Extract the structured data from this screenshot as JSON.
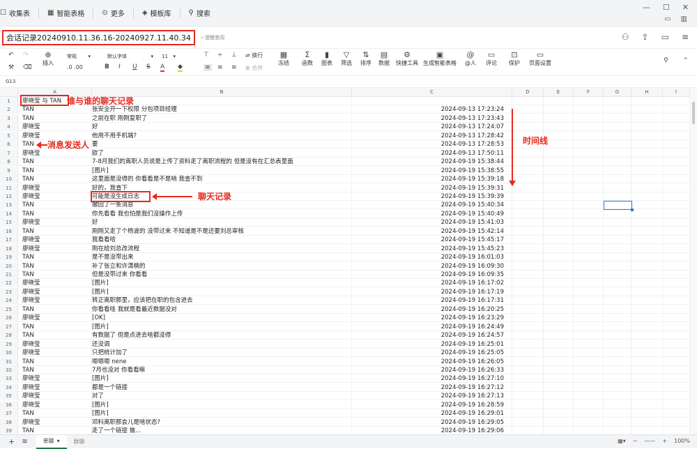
{
  "topbar": {
    "items": [
      {
        "icon": "star-icon",
        "label": "收集表"
      },
      {
        "icon": "table-icon",
        "label": "智能表格"
      },
      {
        "icon": "more-icon",
        "label": "更多"
      },
      {
        "icon": "template-icon",
        "label": "模板库"
      },
      {
        "icon": "search-icon",
        "label": "搜索"
      }
    ]
  },
  "doc": {
    "title": "会话记录20240910.11.36.16-20240927.11.40.34",
    "tag": "提醒查阅"
  },
  "ribbon": {
    "font_format": "常规",
    "font_name": "默认字体",
    "font_size": "11",
    "wrap": "换行",
    "merge": "合并",
    "insert": "插入",
    "groups": [
      "冻结",
      "函数",
      "图表",
      "筛选",
      "排序",
      "数据",
      "快捷工具",
      "生成智能表格",
      "@人",
      "评论",
      "保护",
      "页面设置"
    ]
  },
  "formula": {
    "cell_ref": "G13"
  },
  "columns": [
    "A",
    "B",
    "C",
    "D",
    "E",
    "F",
    "G",
    "H",
    "I"
  ],
  "rows": [
    {
      "a": "廖晓莹 与 TAN",
      "b": "",
      "c": ""
    },
    {
      "a": "TAN",
      "b": "张安全开一下权限  分包项目经理",
      "c": "2024-09-13 17:23:24"
    },
    {
      "a": "TAN",
      "b": "之前在职  刚刚复职了",
      "c": "2024-09-13 17:23:43"
    },
    {
      "a": "廖晓莹",
      "b": "好",
      "c": "2024-09-13 17:24:07"
    },
    {
      "a": "廖晓莹",
      "b": "他用不用手机端?",
      "c": "2024-09-13 17:28:42"
    },
    {
      "a": "TAN",
      "b": "要",
      "c": "2024-09-13 17:28:53"
    },
    {
      "a": "廖晓莹",
      "b": "欧了",
      "c": "2024-09-13 17:50:11"
    },
    {
      "a": "TAN",
      "b": "7-8月我们的离职人员说是上传了资料走了离职流程的    但是没有在汇总表里面",
      "c": "2024-09-19 15:38:44"
    },
    {
      "a": "TAN",
      "b": "[图片]",
      "c": "2024-09-19 15:38:55"
    },
    {
      "a": "TAN",
      "b": "这里面是没得的  你看看是不是呐  我查不到",
      "c": "2024-09-19 15:39:18"
    },
    {
      "a": "廖晓莹",
      "b": "好的，我查下",
      "c": "2024-09-19 15:39:31"
    },
    {
      "a": "廖晓莹",
      "b": "可能是没生成日志",
      "c": "2024-09-19 15:39:39"
    },
    {
      "a": "TAN",
      "b": "撤回了一条消息",
      "c": "2024-09-19 15:40:34"
    },
    {
      "a": "TAN",
      "b": "你先看看  我也怕是我们没操作上传",
      "c": "2024-09-19 15:40:49"
    },
    {
      "a": "廖晓莹",
      "b": "好",
      "c": "2024-09-19 15:41:03"
    },
    {
      "a": "TAN",
      "b": "刚刚又走了个杨波的  没带过来  不知道是不是还要刘总审核",
      "c": "2024-09-19 15:42:14"
    },
    {
      "a": "廖晓莹",
      "b": "我看看哈",
      "c": "2024-09-19 15:45:17"
    },
    {
      "a": "廖晓莹",
      "b": "刚在给刘总改流程",
      "c": "2024-09-19 15:45:23"
    },
    {
      "a": "TAN",
      "b": "是不是没带出来",
      "c": "2024-09-19 16:01:03"
    },
    {
      "a": "TAN",
      "b": "补了张立和许潇楠的",
      "c": "2024-09-19 16:09:30"
    },
    {
      "a": "TAN",
      "b": "但是没带过来  你看看",
      "c": "2024-09-19 16:09:35"
    },
    {
      "a": "廖晓莹",
      "b": "[图片]",
      "c": "2024-09-19 16:17:02"
    },
    {
      "a": "廖晓莹",
      "b": "[图片]",
      "c": "2024-09-19 16:17:19"
    },
    {
      "a": "廖晓莹",
      "b": "转正离职那里，应该把在职的包含进去",
      "c": "2024-09-19 16:17:31"
    },
    {
      "a": "TAN",
      "b": "你看看哇  我就是看最近数据没对",
      "c": "2024-09-19 16:20:25"
    },
    {
      "a": "廖晓莹",
      "b": "[OK]",
      "c": "2024-09-19 16:23:29"
    },
    {
      "a": "TAN",
      "b": "[图片]",
      "c": "2024-09-19 16:24:49"
    },
    {
      "a": "TAN",
      "b": "有数据了  但是点进去啥都没得",
      "c": "2024-09-19 16:24:57"
    },
    {
      "a": "廖晓莹",
      "b": "还没调",
      "c": "2024-09-19 16:25:01"
    },
    {
      "a": "廖晓莹",
      "b": "只把统计加了",
      "c": "2024-09-19 16:25:05"
    },
    {
      "a": "TAN",
      "b": "嗯嗯嗯  nene",
      "c": "2024-09-19 16:26:05"
    },
    {
      "a": "TAN",
      "b": "7月也没对  你看看嘛",
      "c": "2024-09-19 16:26:33"
    },
    {
      "a": "廖晓莹",
      "b": "[图片]",
      "c": "2024-09-19 16:27:10"
    },
    {
      "a": "廖晓莹",
      "b": "都是一个链接",
      "c": "2024-09-19 16:27:12"
    },
    {
      "a": "廖晓莹",
      "b": "对了",
      "c": "2024-09-19 16:27:13"
    },
    {
      "a": "廖晓莹",
      "b": "[图片]",
      "c": "2024-09-19 16:28:59"
    },
    {
      "a": "TAN",
      "b": "[图片]",
      "c": "2024-09-19 16:29:01"
    },
    {
      "a": "廖晓莹",
      "b": "邓科离职那会儿是啥状态?",
      "c": "2024-09-19 16:29:05"
    },
    {
      "a": "TAN",
      "b": "走了一个链接  做...",
      "c": "2024-09-19 16:29:06"
    }
  ],
  "annotations": {
    "who_with_who": "谁与谁的聊天记录",
    "sender": "消息发送人",
    "record": "聊天记录",
    "timeline": "时间线"
  },
  "sheets": [
    {
      "label": "单聊",
      "active": true
    },
    {
      "label": "群聊",
      "active": false
    }
  ],
  "zoom": "100%",
  "colors": {
    "accent_red": "#e8281d",
    "selection_blue": "#3173e3"
  }
}
